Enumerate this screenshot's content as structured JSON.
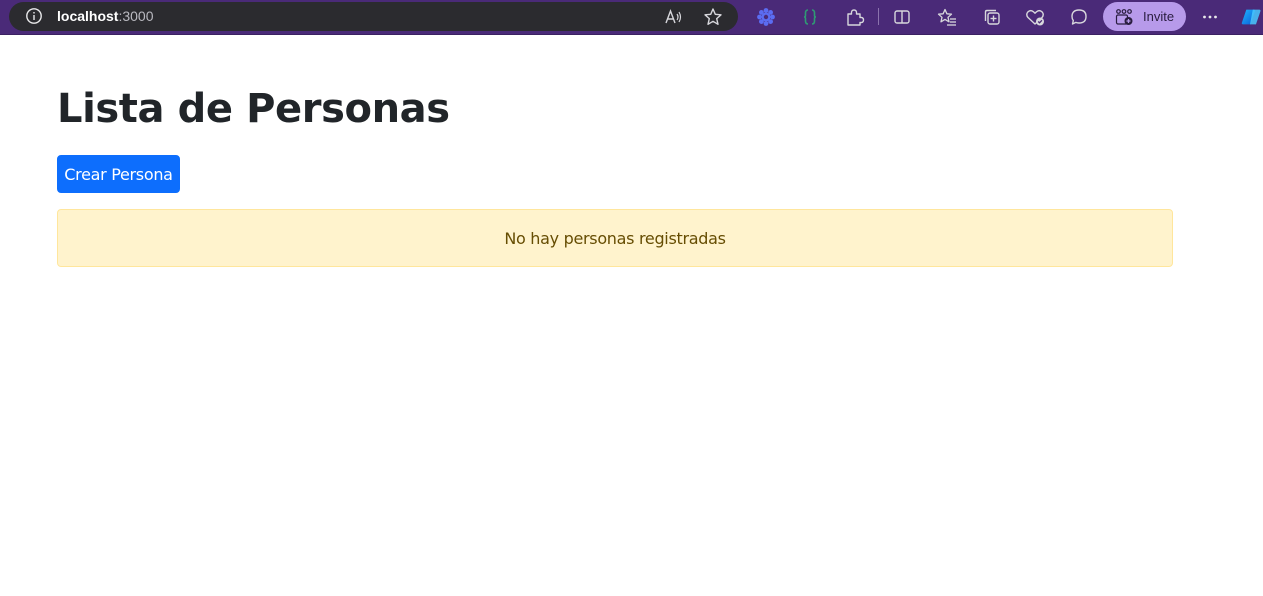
{
  "browser": {
    "url_host": "localhost",
    "url_port": ":3000",
    "invite_label": "Invite",
    "icons": [
      "info-icon",
      "read-aloud-icon",
      "favorite-star-icon",
      "extension-flower-icon",
      "extension-braces-icon",
      "extensions-puzzle-icon",
      "split-screen-icon",
      "favorites-icon",
      "collections-icon",
      "browser-essentials-icon",
      "feedback-icon",
      "workspaces-icon",
      "more-options-icon",
      "copilot-icon"
    ],
    "colors": {
      "toolbar": "#4a2a78",
      "address_bar": "#2b2b2f",
      "invite_button": "#b79aea"
    }
  },
  "page": {
    "title": "Lista de Personas",
    "create_button_label": "Crear Persona",
    "empty_message": "No hay personas registradas",
    "colors": {
      "primary": "#0d6efd",
      "alert_background": "#fff3cd",
      "alert_text": "#664d03"
    }
  }
}
